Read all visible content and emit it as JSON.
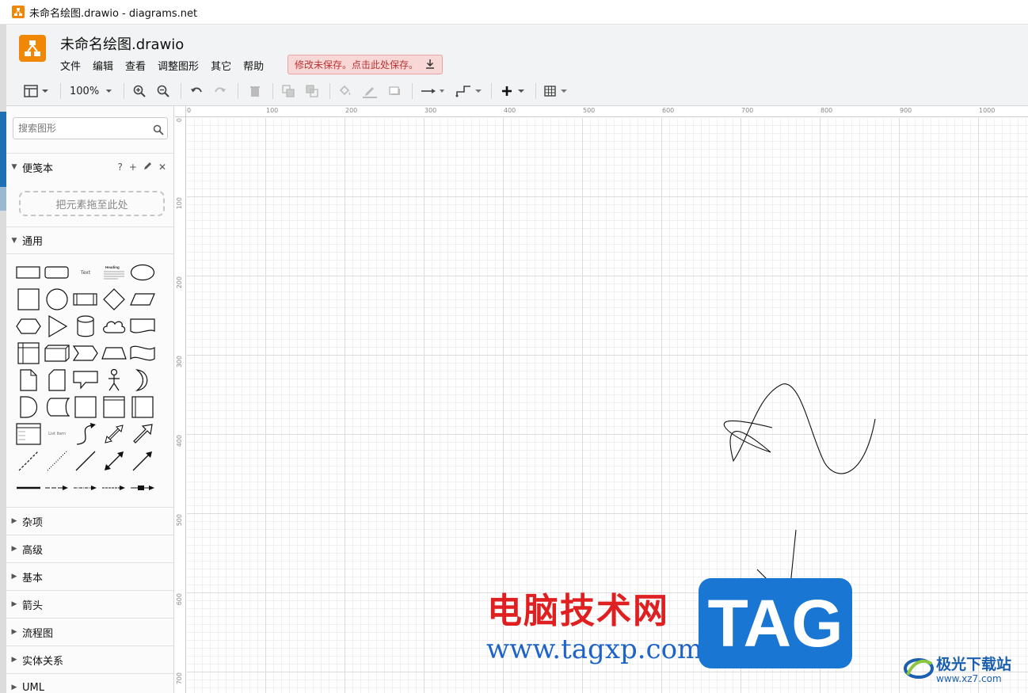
{
  "window": {
    "title": "未命名绘图.drawio - diagrams.net"
  },
  "header": {
    "doc_title": "未命名绘图.drawio",
    "menus": [
      "文件",
      "编辑",
      "查看",
      "调整图形",
      "其它",
      "帮助"
    ],
    "save_banner": "修改未保存。点击此处保存。"
  },
  "toolbar": {
    "zoom": "100%",
    "icons": [
      "layout-icon",
      "zoom-in-icon",
      "zoom-out-icon",
      "undo-icon",
      "redo-icon",
      "delete-icon",
      "to-front-icon",
      "to-back-icon",
      "fill-color-icon",
      "line-color-icon",
      "shadow-icon",
      "connection-icon",
      "waypoints-icon",
      "insert-icon",
      "table-icon"
    ]
  },
  "sidebar": {
    "search_placeholder": "搜索图形",
    "scratchpad": {
      "title": "便笺本",
      "dropzone": "把元素拖至此处",
      "help": "?"
    },
    "general": {
      "title": "通用",
      "text_shape": "Text",
      "heading_shape": "Heading",
      "list_item": "List Item"
    },
    "sections": [
      "杂项",
      "高级",
      "基本",
      "箭头",
      "流程图",
      "实体关系",
      "UML"
    ]
  },
  "canvas": {
    "ruler_x": [
      "0",
      "100",
      "200",
      "300",
      "400",
      "500",
      "600",
      "700",
      "800",
      "900",
      "1000"
    ],
    "ruler_y": [
      "0",
      "100",
      "200",
      "300",
      "400",
      "500",
      "600",
      "700"
    ]
  },
  "watermark": {
    "cn": "电脑技术网",
    "url": "www.tagxp.com",
    "tag": "TAG",
    "site_cn": "极光下载站",
    "site_url": "www.xz7.com"
  },
  "colors": {
    "brand": "#f08705",
    "banner_bg": "#f8d7d7",
    "banner_text": "#b33333",
    "tag_blue": "#1976d2"
  }
}
